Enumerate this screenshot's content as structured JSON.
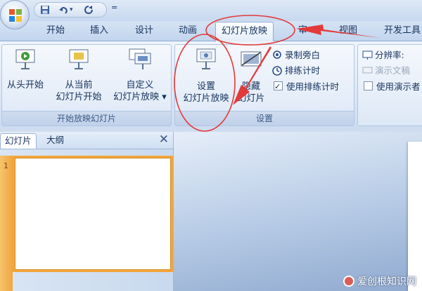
{
  "quick_access": {
    "save_icon": "save-icon",
    "undo_icon": "undo-icon",
    "redo_icon": "redo-icon",
    "customize": "="
  },
  "tabs": [
    {
      "label": "开始",
      "active": false
    },
    {
      "label": "插入",
      "active": false
    },
    {
      "label": "设计",
      "active": false
    },
    {
      "label": "动画",
      "active": false
    },
    {
      "label": "幻灯片放映",
      "active": true
    },
    {
      "label": "审",
      "active": false
    },
    {
      "label": "视图",
      "active": false
    },
    {
      "label": "开发工具",
      "active": false
    }
  ],
  "ribbon": {
    "group_start": {
      "label": "开始放映幻灯片",
      "from_beginning": "从头开始",
      "from_current": [
        "从当前",
        "幻灯片开始"
      ],
      "custom": [
        "自定义",
        "幻灯片放映 ▾"
      ]
    },
    "group_setup": {
      "label": "设置",
      "setup_show": [
        "设置",
        "幻灯片放映"
      ],
      "hide_slide": [
        "隐藏",
        "幻灯片"
      ],
      "record_narration": "录制旁白",
      "rehearse_timings": "排练计时",
      "use_rehearsed_timings": "使用排练计时",
      "use_rehearsed_checked": true
    },
    "group_monitors": {
      "resolution": "分辨率:",
      "show_presentation_on": "演示文稿",
      "use_presenter_view": "使用演示者"
    }
  },
  "pane": {
    "tab_slides": "幻灯片",
    "tab_outline": "大纲",
    "close": "✕",
    "slide_number": "1"
  },
  "watermark": "爱创根知识网",
  "colors": {
    "annotation_red": "#e23a3a",
    "thumbnail_highlight": "#f2a63c",
    "ribbon_text": "#15325c"
  }
}
